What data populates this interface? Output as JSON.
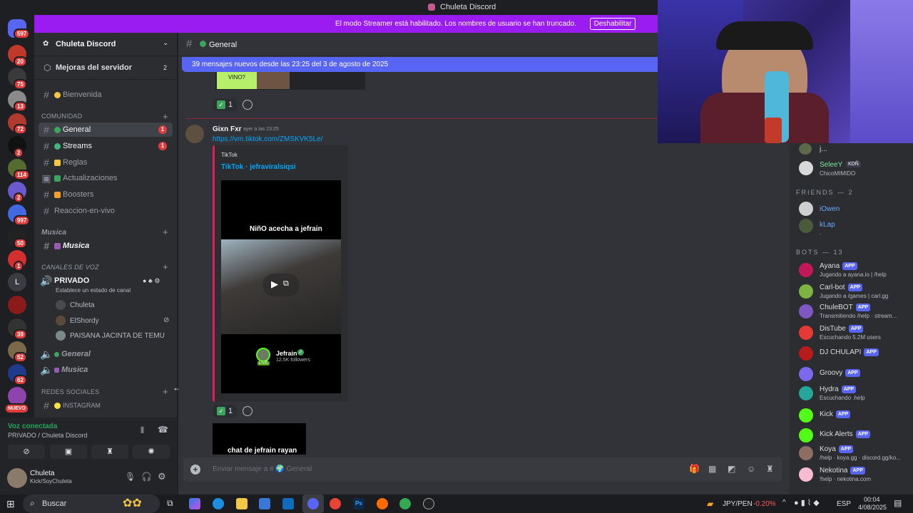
{
  "window": {
    "title": "Chuleta Discord"
  },
  "banner": {
    "text": "El modo Streamer está habilitado. Los nombres de usuario se han truncado.",
    "button": "Deshabilitar"
  },
  "rail_badges": [
    "597",
    "20",
    "75",
    "13",
    "72",
    "2",
    "114",
    "2",
    "997",
    "50",
    "1",
    "39",
    "52",
    "62",
    "NUEVO"
  ],
  "sidebar": {
    "server_name": "Chuleta Discord",
    "boost_label": "Mejoras del servidor",
    "boost_count": "2",
    "welcome": "Bienvenida",
    "cat_comunidad": "COMUNIDAD",
    "ch_general": "General",
    "ch_general_badge": "1",
    "ch_streams": "Streams",
    "ch_streams_badge": "1",
    "ch_reglas": "Reglas",
    "ch_actualizaciones": "Actualizaciones",
    "ch_boosters": "Boosters",
    "ch_reaccion": "Reaccion-en-vivo",
    "cat_musica": "Musica",
    "ch_musica": "Musica",
    "cat_voz": "CANALES DE VOZ",
    "voice_privado": "PRIVADO",
    "voice_status_hint": "Establece un estado de canal",
    "voice_users": [
      "Chuleta",
      "ElShordy",
      "PAISANA JACINTA DE TEMU"
    ],
    "voice_general": "General",
    "voice_musica": "Musica",
    "cat_redes": "REDES SOCIALES",
    "ch_instagram": "INSTAGRAM"
  },
  "voice_panel": {
    "status": "Voz conectada",
    "channel": "PRIVADO / Chuleta Discord"
  },
  "user_panel": {
    "name": "Chuleta",
    "status": "Kick/SoyChuleta"
  },
  "chat": {
    "channel": "General",
    "new_messages": "39 mensajes nuevos desde las 23:25 del 3 de agosto de 2025",
    "prev_image_text": "VINO?",
    "reaction_count_1": "1",
    "author": "Gixn Fxr",
    "timestamp": "ayer a las 23:25",
    "link": "https://vm.tiktok.com/ZMSKVK5Le/",
    "embed_provider": "TikTok",
    "embed_title": "TikTok · jefraviralsiqsi",
    "video_caption": "NiñO acecha a jefrain",
    "video_account": "Jefrain",
    "video_followers": "12.5K followers",
    "video_live": "LIVE",
    "reaction_count_2": "1",
    "next_image_text": "chat de jefrain rayan",
    "input_placeholder": "Enviar mensaje a # 🌍 General"
  },
  "members": {
    "top_partial": "j...",
    "selee_name": "SeleeY",
    "selee_tag": "KDÑ",
    "selee_status": "ChicoMIMIDO",
    "friends_header": "FRIENDS — 2",
    "friends": [
      {
        "name": "iOwen",
        "status": ""
      },
      {
        "name": "kLap",
        "status": "."
      }
    ],
    "bots_header": "BOTS — 13",
    "app_label": "APP",
    "bots": [
      {
        "name": "Ayana",
        "status": "Jugando a ayana.io | /help",
        "color": "#c2185b"
      },
      {
        "name": "Carl-bot",
        "status": "Jugando a /games | carl.gg",
        "color": "#7cb342"
      },
      {
        "name": "ChuleBOT",
        "status": "Transmitiendo /help · stream...",
        "color": "#7e57c2"
      },
      {
        "name": "DisTube",
        "status": "Escuchando 5.2M users",
        "color": "#e53935"
      },
      {
        "name": "DJ CHULAPI",
        "status": "",
        "color": "#b71c1c"
      },
      {
        "name": "Groovy",
        "status": "",
        "color": "#7b68ee"
      },
      {
        "name": "Hydra",
        "status": "Escuchando .help",
        "color": "#26a69a"
      },
      {
        "name": "Kick",
        "status": "",
        "color": "#53fc18"
      },
      {
        "name": "Kick Alerts",
        "status": "",
        "color": "#53fc18"
      },
      {
        "name": "Koya",
        "status": "/help · koya.gg · discord.gg/ko...",
        "color": "#8d6e63"
      },
      {
        "name": "Nekotina",
        "status": "!help · nekotina.com",
        "color": "#f8bbd0"
      }
    ]
  },
  "taskbar": {
    "search_label": "Buscar",
    "ticker": "JPY/PEN",
    "ticker_change": "-0.20%",
    "lang": "ESP",
    "time": "00:04",
    "date": "4/08/2025"
  }
}
